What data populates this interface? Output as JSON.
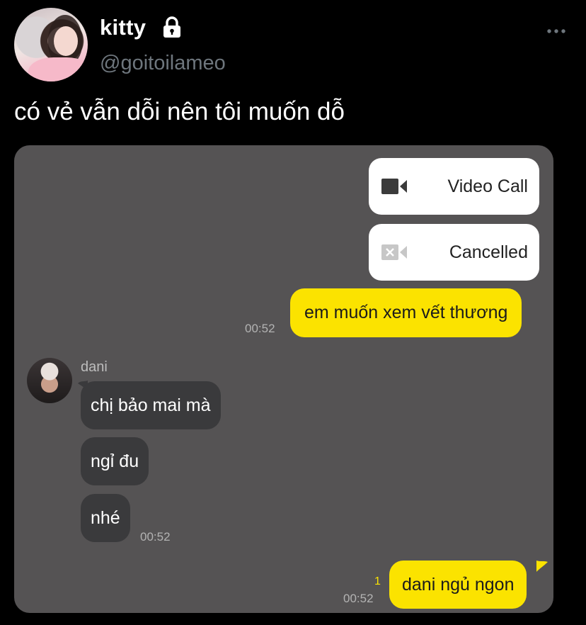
{
  "tweet": {
    "username": "kitty",
    "handle": "@goitoilameo",
    "text": "có vẻ vẫn dỗi nên tôi muốn dỗ",
    "icons": {
      "lock": "lock-icon",
      "more": "more-dots-icon"
    }
  },
  "chat": {
    "calls": [
      {
        "label": "Video Call",
        "icon": "video-camera-icon",
        "state": "active"
      },
      {
        "label": "Cancelled",
        "icon": "video-camera-cancelled-icon",
        "state": "cancelled"
      }
    ],
    "sent_1": {
      "text": "em muốn xem vết thương",
      "time": "00:52"
    },
    "contact": {
      "name": "dani"
    },
    "received": [
      {
        "text": "chị bảo mai mà"
      },
      {
        "text": "ngỉ đu"
      },
      {
        "text": "nhé",
        "time": "00:52"
      }
    ],
    "sent_2": {
      "text": "dani ngủ ngon",
      "time": "00:52",
      "unread_count": "1"
    }
  },
  "colors": {
    "background": "#000000",
    "chat_background": "#555354",
    "sent_bubble": "#fbe300",
    "received_bubble": "#3a3a3c",
    "handle_gray": "#6e767d"
  }
}
